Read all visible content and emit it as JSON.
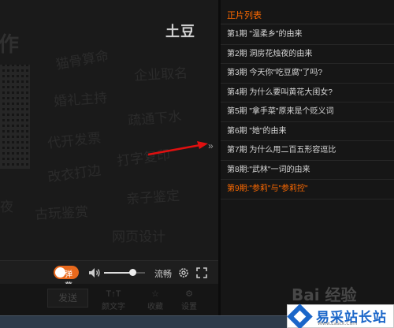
{
  "video": {
    "logo": "土豆",
    "bg_words": [
      "作",
      "猫骨算命",
      "企业取名",
      "婚礼主持",
      "疏通下水",
      "代开发票",
      "打字复印",
      "改衣打边",
      "亲子鉴定",
      "古玩鉴赏",
      "夜",
      "网页设计"
    ]
  },
  "controls": {
    "danmu_label": "弹幕",
    "volume_level": 0.7,
    "quality": "流畅",
    "accent_color": "#e8691d"
  },
  "bottom_bar": {
    "send_label": "发送",
    "tools": [
      {
        "icon": "t-icon",
        "label": "颜文字"
      },
      {
        "icon": "star-icon",
        "label": "收藏"
      },
      {
        "icon": "gear-icon",
        "label": "设置"
      }
    ]
  },
  "playlist": {
    "title": "正片列表",
    "title_color": "#ff6a00",
    "episodes": [
      "第1期 \"温柔乡\"的由来",
      "第2期 洞房花烛夜的由来",
      "第3期 今天你\"吃豆腐\"了吗?",
      "第4期 为什么要叫黄花大闺女?",
      "第5期 \"拿手菜\"原来是个贬义词",
      "第6期 \"她\"的由来",
      "第7期 为什么用二百五形容逗比",
      "第8期:\"武林\"一词的由来",
      "第9期:\"参莉\"与\"参莉控\""
    ],
    "active_index": 8
  },
  "watermark": {
    "baidu": "Bai 经验",
    "site_name": "易采站长站",
    "site_url": "Www.Easck.Com"
  }
}
